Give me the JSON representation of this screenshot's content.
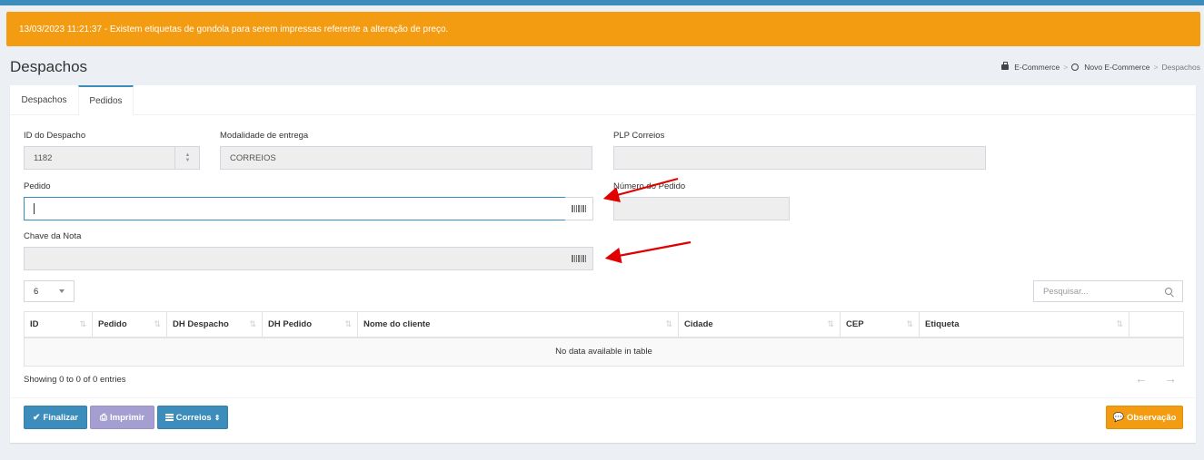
{
  "alert": {
    "text": "13/03/2023 11:21:37 - Existem etiquetas de gondola para serem impressas referente a alteração de preço."
  },
  "page": {
    "title": "Despachos"
  },
  "breadcrumb": {
    "items": [
      "E-Commerce",
      "Novo E-Commerce",
      "Despachos"
    ],
    "separator": ">"
  },
  "tabs": [
    "Despachos",
    "Pedidos"
  ],
  "form": {
    "id_despacho": {
      "label": "ID do Despacho",
      "value": "1182"
    },
    "modalidade": {
      "label": "Modalidade de entrega",
      "value": "CORREIOS"
    },
    "plp": {
      "label": "PLP Correios",
      "value": ""
    },
    "pedido": {
      "label": "Pedido",
      "value": ""
    },
    "numero_pedido": {
      "label": "Número do Pedido",
      "value": ""
    },
    "chave_nota": {
      "label": "Chave da Nota",
      "value": ""
    }
  },
  "table": {
    "page_length": "6",
    "search_placeholder": "Pesquisar...",
    "columns": [
      "ID",
      "Pedido",
      "DH Despacho",
      "DH Pedido",
      "Nome do cliente",
      "Cidade",
      "CEP",
      "Etiqueta",
      ""
    ],
    "empty_text": "No data available in table",
    "info": "Showing 0 to 0 of 0 entries",
    "prev": "←",
    "next": "→",
    "sort_glyph": "⇅"
  },
  "buttons": {
    "finalizar": "Finalizar",
    "imprimir": "Imprimir",
    "correios": "Correios",
    "observacao": "Observação"
  },
  "colors": {
    "alert": "#f39c12",
    "primary": "#3c8dbc",
    "purple": "#a59fd1",
    "annotation": "#e00000"
  }
}
